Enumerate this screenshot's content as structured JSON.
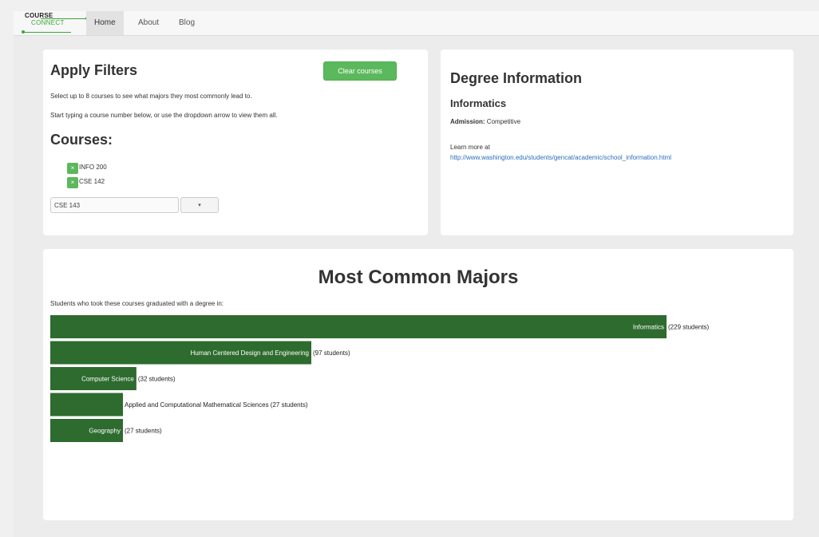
{
  "nav": {
    "logo_top": "COURSE",
    "logo_bottom": "CONNECT",
    "items": [
      {
        "label": "Home",
        "active": true
      },
      {
        "label": "About",
        "active": false
      },
      {
        "label": "Blog",
        "active": false
      }
    ]
  },
  "filters": {
    "title": "Apply Filters",
    "clear_label": "Clear courses",
    "help1": "Select up to 8 courses to see what majors they most commonly lead to.",
    "help2": "Start typing a course number below, or use the dropdown arrow to view them all.",
    "courses_title": "Courses:",
    "remove_glyph": "×",
    "selected_courses": [
      "INFO 200",
      "CSE 142"
    ],
    "input_value": "CSE 143",
    "dropdown_glyph": "▾"
  },
  "degree": {
    "title": "Degree Information",
    "major": "Informatics",
    "admission_label": "Admission:",
    "admission_value": "Competitive",
    "learn_more": "Learn more at",
    "link": "http://www.washington.edu/students/gencat/academic/school_information.html"
  },
  "majors": {
    "title": "Most Common Majors",
    "subtitle": "Students who took these courses graduated with a degree in:"
  },
  "colors": {
    "bar": "#2e6b2e",
    "accent": "#5cb85c"
  },
  "chart_data": {
    "type": "bar",
    "orientation": "horizontal",
    "categories": [
      "Informatics",
      "Human Centered Design and Engineering",
      "Computer Science",
      "Applied and Computational Mathematical Sciences",
      "Geography"
    ],
    "values": [
      229,
      97,
      32,
      27,
      27
    ],
    "value_labels": [
      "(229 students)",
      "(97 students)",
      "(32 students)",
      "(27 students)",
      "(27 students)"
    ],
    "label_inside": [
      true,
      true,
      true,
      false,
      true
    ],
    "xlim": [
      0,
      229
    ]
  }
}
